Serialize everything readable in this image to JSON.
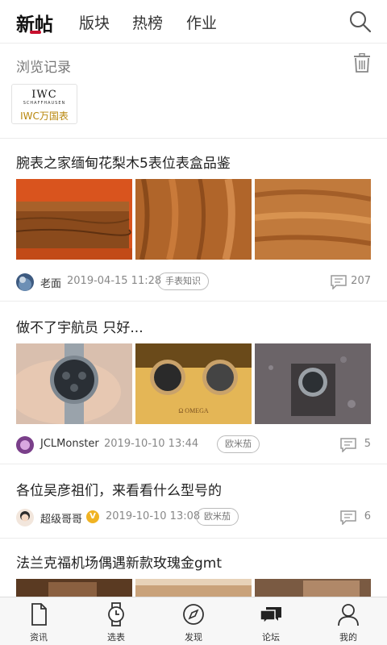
{
  "top_nav": {
    "tabs": [
      "新帖",
      "版块",
      "热榜",
      "作业"
    ],
    "active_tab": "新帖",
    "accent_color": "#c8102e"
  },
  "history": {
    "title": "浏览记录",
    "items": [
      {
        "logo_text": "IWC",
        "logo_sub": "SCHAFFHAUSEN",
        "name": "IWC万国表"
      }
    ]
  },
  "posts": [
    {
      "title": "腕表之家缅甸花梨木5表位表盒品鉴",
      "thumbnails": [
        "wooden-watch-box",
        "wood-grain-closeup",
        "wood-grain-closeup-2"
      ],
      "author": "老面",
      "date": "2019-04-15 11:28",
      "tag": "手表知识",
      "comments": "207"
    },
    {
      "title": "做不了宇航员 只好...",
      "thumbnails": [
        "watch-on-hand",
        "omega-watches-display",
        "watch-on-stand"
      ],
      "author": "JCLMonster",
      "date": "2019-10-10 13:44",
      "tag": "欧米茄",
      "comments": "5"
    },
    {
      "title": "各位吴彦祖们，来看看什么型号的",
      "thumbnails": [],
      "author": "超级哥哥",
      "author_badge": "V",
      "date": "2019-10-10 13:08",
      "tag": "欧米茄",
      "comments": "6"
    },
    {
      "title": "法兰克福机场偶遇新款玫瑰金gmt",
      "thumbnails": [
        "airport-photo-1",
        "airport-photo-2",
        "airport-photo-3"
      ]
    }
  ],
  "bottom_nav": {
    "items": [
      {
        "label": "资讯",
        "icon": "document-icon"
      },
      {
        "label": "选表",
        "icon": "watch-icon"
      },
      {
        "label": "发现",
        "icon": "compass-icon"
      },
      {
        "label": "论坛",
        "icon": "chat-bubbles-icon",
        "active": true
      },
      {
        "label": "我的",
        "icon": "user-icon"
      }
    ]
  }
}
